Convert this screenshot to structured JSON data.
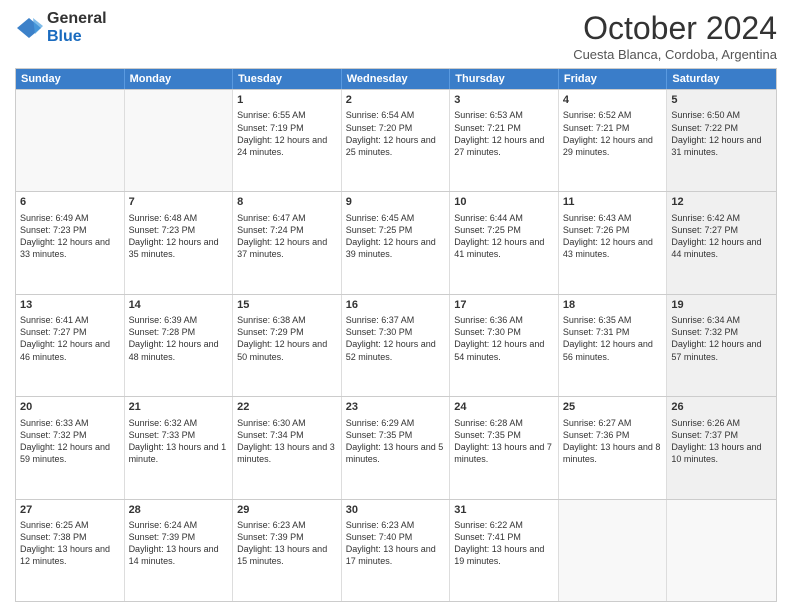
{
  "header": {
    "logo_general": "General",
    "logo_blue": "Blue",
    "month_title": "October 2024",
    "subtitle": "Cuesta Blanca, Cordoba, Argentina"
  },
  "days_of_week": [
    "Sunday",
    "Monday",
    "Tuesday",
    "Wednesday",
    "Thursday",
    "Friday",
    "Saturday"
  ],
  "weeks": [
    [
      {
        "day": "",
        "text": "",
        "empty": true
      },
      {
        "day": "",
        "text": "",
        "empty": true
      },
      {
        "day": "1",
        "text": "Sunrise: 6:55 AM\nSunset: 7:19 PM\nDaylight: 12 hours and 24 minutes."
      },
      {
        "day": "2",
        "text": "Sunrise: 6:54 AM\nSunset: 7:20 PM\nDaylight: 12 hours and 25 minutes."
      },
      {
        "day": "3",
        "text": "Sunrise: 6:53 AM\nSunset: 7:21 PM\nDaylight: 12 hours and 27 minutes."
      },
      {
        "day": "4",
        "text": "Sunrise: 6:52 AM\nSunset: 7:21 PM\nDaylight: 12 hours and 29 minutes."
      },
      {
        "day": "5",
        "text": "Sunrise: 6:50 AM\nSunset: 7:22 PM\nDaylight: 12 hours and 31 minutes.",
        "shaded": true
      }
    ],
    [
      {
        "day": "6",
        "text": "Sunrise: 6:49 AM\nSunset: 7:23 PM\nDaylight: 12 hours and 33 minutes."
      },
      {
        "day": "7",
        "text": "Sunrise: 6:48 AM\nSunset: 7:23 PM\nDaylight: 12 hours and 35 minutes."
      },
      {
        "day": "8",
        "text": "Sunrise: 6:47 AM\nSunset: 7:24 PM\nDaylight: 12 hours and 37 minutes."
      },
      {
        "day": "9",
        "text": "Sunrise: 6:45 AM\nSunset: 7:25 PM\nDaylight: 12 hours and 39 minutes."
      },
      {
        "day": "10",
        "text": "Sunrise: 6:44 AM\nSunset: 7:25 PM\nDaylight: 12 hours and 41 minutes."
      },
      {
        "day": "11",
        "text": "Sunrise: 6:43 AM\nSunset: 7:26 PM\nDaylight: 12 hours and 43 minutes."
      },
      {
        "day": "12",
        "text": "Sunrise: 6:42 AM\nSunset: 7:27 PM\nDaylight: 12 hours and 44 minutes.",
        "shaded": true
      }
    ],
    [
      {
        "day": "13",
        "text": "Sunrise: 6:41 AM\nSunset: 7:27 PM\nDaylight: 12 hours and 46 minutes."
      },
      {
        "day": "14",
        "text": "Sunrise: 6:39 AM\nSunset: 7:28 PM\nDaylight: 12 hours and 48 minutes."
      },
      {
        "day": "15",
        "text": "Sunrise: 6:38 AM\nSunset: 7:29 PM\nDaylight: 12 hours and 50 minutes."
      },
      {
        "day": "16",
        "text": "Sunrise: 6:37 AM\nSunset: 7:30 PM\nDaylight: 12 hours and 52 minutes."
      },
      {
        "day": "17",
        "text": "Sunrise: 6:36 AM\nSunset: 7:30 PM\nDaylight: 12 hours and 54 minutes."
      },
      {
        "day": "18",
        "text": "Sunrise: 6:35 AM\nSunset: 7:31 PM\nDaylight: 12 hours and 56 minutes."
      },
      {
        "day": "19",
        "text": "Sunrise: 6:34 AM\nSunset: 7:32 PM\nDaylight: 12 hours and 57 minutes.",
        "shaded": true
      }
    ],
    [
      {
        "day": "20",
        "text": "Sunrise: 6:33 AM\nSunset: 7:32 PM\nDaylight: 12 hours and 59 minutes."
      },
      {
        "day": "21",
        "text": "Sunrise: 6:32 AM\nSunset: 7:33 PM\nDaylight: 13 hours and 1 minute."
      },
      {
        "day": "22",
        "text": "Sunrise: 6:30 AM\nSunset: 7:34 PM\nDaylight: 13 hours and 3 minutes."
      },
      {
        "day": "23",
        "text": "Sunrise: 6:29 AM\nSunset: 7:35 PM\nDaylight: 13 hours and 5 minutes."
      },
      {
        "day": "24",
        "text": "Sunrise: 6:28 AM\nSunset: 7:35 PM\nDaylight: 13 hours and 7 minutes."
      },
      {
        "day": "25",
        "text": "Sunrise: 6:27 AM\nSunset: 7:36 PM\nDaylight: 13 hours and 8 minutes."
      },
      {
        "day": "26",
        "text": "Sunrise: 6:26 AM\nSunset: 7:37 PM\nDaylight: 13 hours and 10 minutes.",
        "shaded": true
      }
    ],
    [
      {
        "day": "27",
        "text": "Sunrise: 6:25 AM\nSunset: 7:38 PM\nDaylight: 13 hours and 12 minutes."
      },
      {
        "day": "28",
        "text": "Sunrise: 6:24 AM\nSunset: 7:39 PM\nDaylight: 13 hours and 14 minutes."
      },
      {
        "day": "29",
        "text": "Sunrise: 6:23 AM\nSunset: 7:39 PM\nDaylight: 13 hours and 15 minutes."
      },
      {
        "day": "30",
        "text": "Sunrise: 6:23 AM\nSunset: 7:40 PM\nDaylight: 13 hours and 17 minutes."
      },
      {
        "day": "31",
        "text": "Sunrise: 6:22 AM\nSunset: 7:41 PM\nDaylight: 13 hours and 19 minutes."
      },
      {
        "day": "",
        "text": "",
        "empty": true
      },
      {
        "day": "",
        "text": "",
        "empty": true,
        "shaded": true
      }
    ]
  ]
}
